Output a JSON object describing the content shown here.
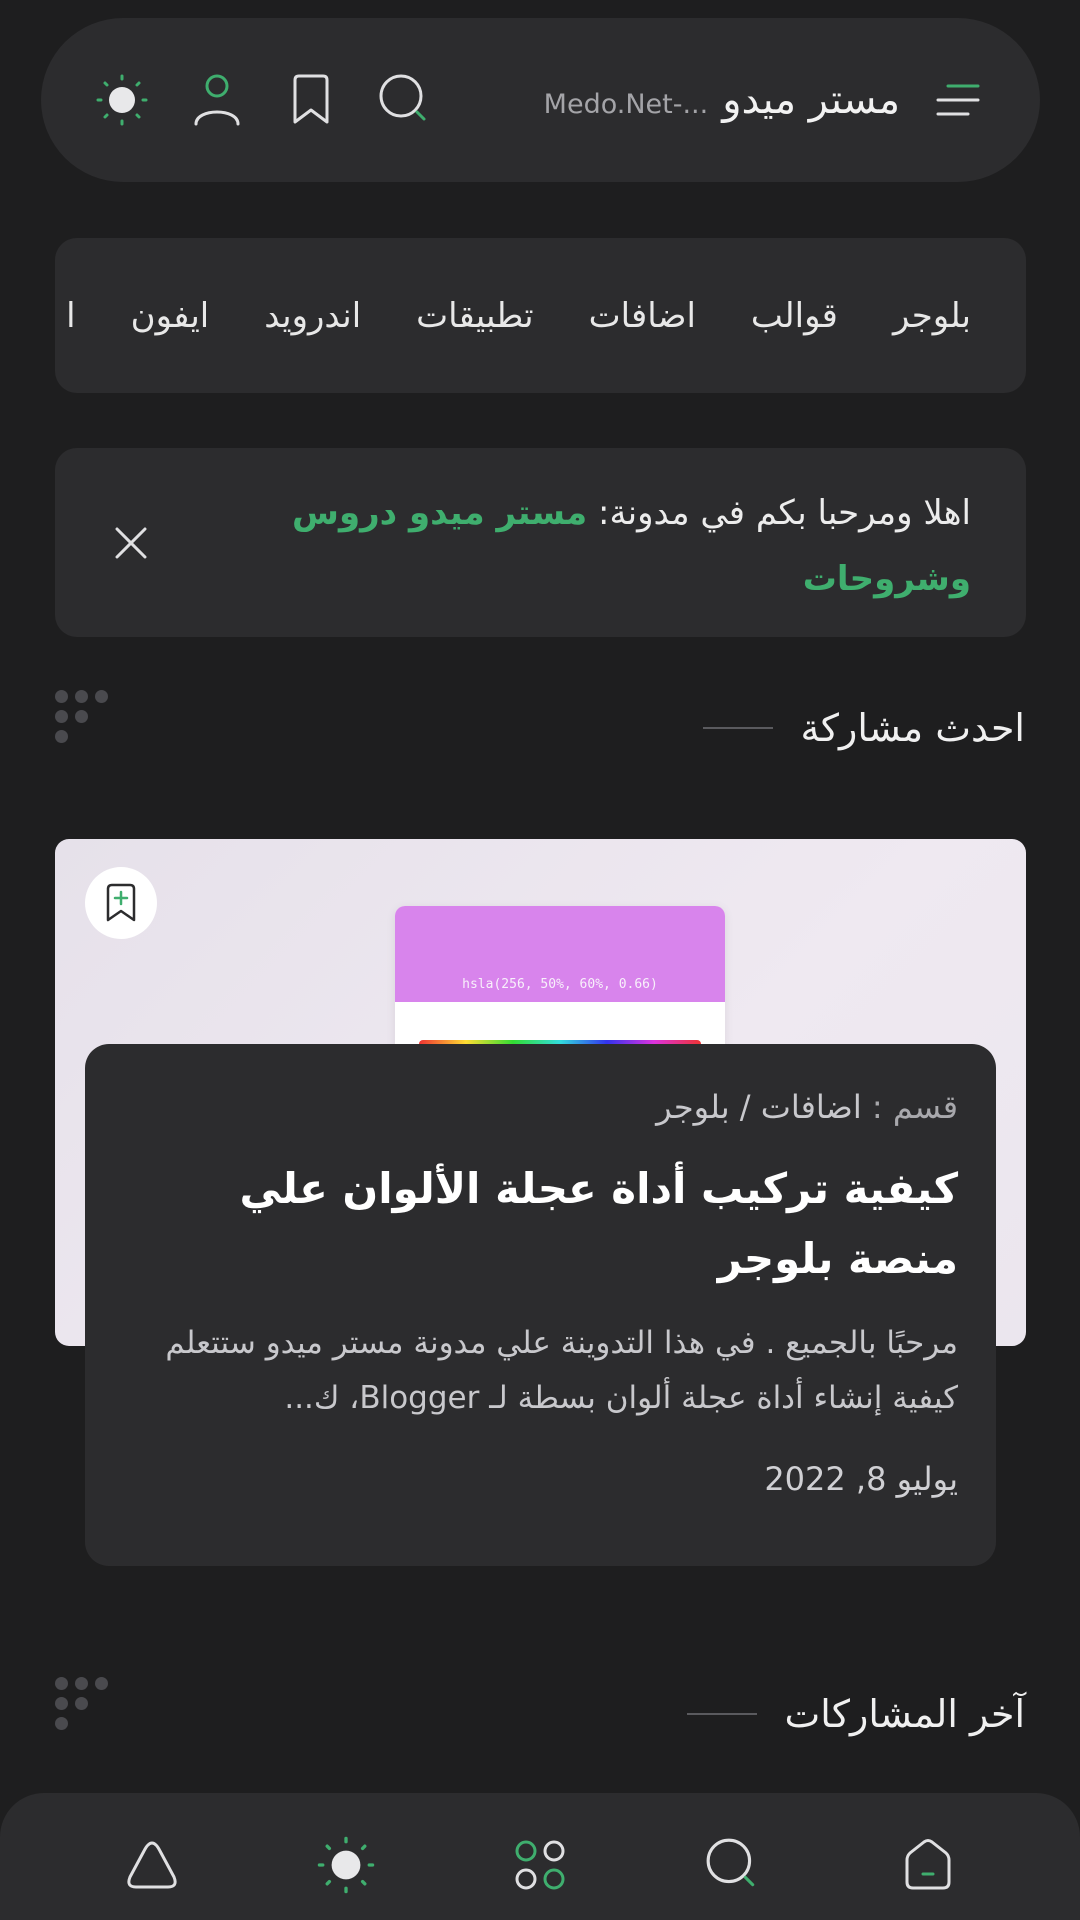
{
  "header": {
    "site_name": "مستر ميدو",
    "site_sub": "Medo.Net-...",
    "icons": [
      "menu-icon",
      "search-icon",
      "bookmark-icon",
      "user-icon",
      "theme-icon"
    ]
  },
  "categories": [
    "بلوجر",
    "قوالب",
    "اضافات",
    "تطبيقات",
    "اندرويد",
    "ايفون",
    "ا"
  ],
  "welcome": {
    "text": "اهلا ومرحبا بكم في مدونة: ",
    "highlight": "مستر ميدو دروس وشروحات"
  },
  "featured_section": {
    "title": "احدث مشاركة"
  },
  "featured_post": {
    "image_caption": "hsla(256, 50%, 60%, 0.66)",
    "category_label": "قسم :",
    "category_path": "اضافات / بلوجر",
    "title": "كيفية تركيب أداة عجلة الألوان علي منصة بلوجر",
    "excerpt": "مرحبًا بالجميع . في هذا التدوينة علي مدونة مستر ميدو ستتعلم كيفية إنشاء أداة عجلة ألوان بسطة لـ Blogger، ك...",
    "date": "يوليو 8, 2022"
  },
  "latest_section": {
    "title": "آخر المشاركات"
  },
  "bottom_nav": [
    "home-icon",
    "search-icon",
    "apps-icon",
    "theme-icon",
    "shape-icon"
  ],
  "colors": {
    "accent": "#3fae6e",
    "surface": "#2c2c2e",
    "background": "#1e1e1f"
  }
}
